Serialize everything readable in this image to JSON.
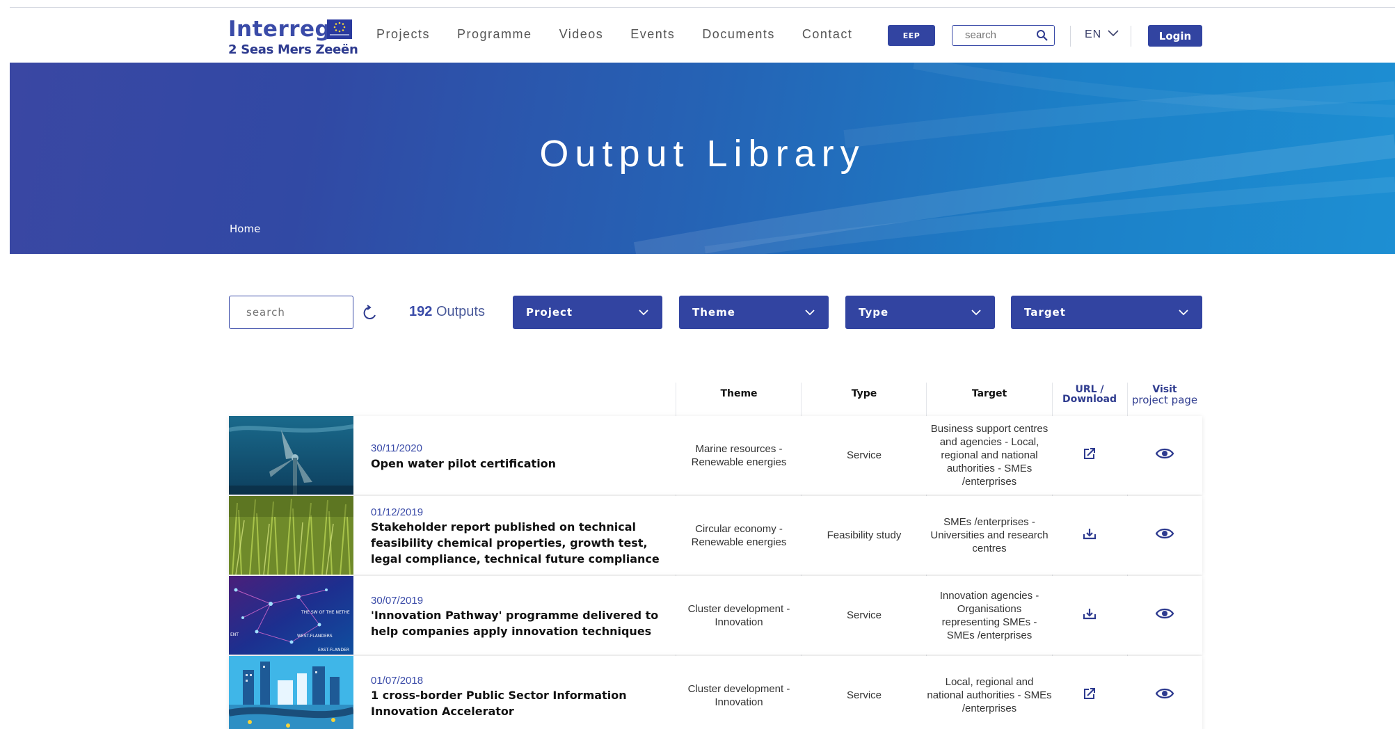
{
  "header": {
    "logo_word": "Interreg",
    "logo_sub": "2 Seas Mers Zeeën",
    "nav": [
      "Projects",
      "Programme",
      "Videos",
      "Events",
      "Documents",
      "Contact"
    ],
    "eep_label": "EEP",
    "search_placeholder": "search",
    "language": "EN",
    "login_label": "Login"
  },
  "hero": {
    "title": "Output Library",
    "breadcrumb": "Home"
  },
  "filters": {
    "search_placeholder": "search",
    "count": "192",
    "count_label": "Outputs",
    "dropdowns": [
      "Project",
      "Theme",
      "Type",
      "Target"
    ]
  },
  "table": {
    "headers": {
      "theme": "Theme",
      "type": "Type",
      "target": "Target",
      "url_line1": "URL /",
      "url_line2": "Download",
      "visit_line1": "Visit",
      "visit_line2": "project page"
    },
    "rows": [
      {
        "date": "30/11/2020",
        "title": "Open water pilot certification",
        "theme": "Marine resources - Renewable energies",
        "type": "Service",
        "target": "Business support centres and agencies - Local, regional and national authorities - SMEs /enterprises",
        "link_icon": "external-link-icon",
        "visit_icon": "eye-icon"
      },
      {
        "date": "01/12/2019",
        "title": "Stakeholder report published on technical feasibility chemical properties, growth test, legal compliance, technical future compliance",
        "theme": "Circular economy - Renewable energies",
        "type": "Feasibility study",
        "target": "SMEs /enterprises - Universities and research centres",
        "link_icon": "download-icon",
        "visit_icon": "eye-icon"
      },
      {
        "date": "30/07/2019",
        "title": "'Innovation Pathway' programme delivered to help companies apply innovation techniques",
        "theme": "Cluster development - Innovation",
        "type": "Service",
        "target": "Innovation agencies - Organisations representing SMEs - SMEs /enterprises",
        "link_icon": "download-icon",
        "visit_icon": "eye-icon"
      },
      {
        "date": "01/07/2018",
        "title": "1 cross-border Public Sector Information Innovation Accelerator",
        "theme": "Cluster development - Innovation",
        "type": "Service",
        "target": "Local, regional and national authorities - SMEs /enterprises",
        "link_icon": "external-link-icon",
        "visit_icon": "eye-icon"
      }
    ]
  },
  "colors": {
    "brand": "#3244a1",
    "hero_start": "#3a47a3",
    "hero_end": "#1d8fd3"
  }
}
